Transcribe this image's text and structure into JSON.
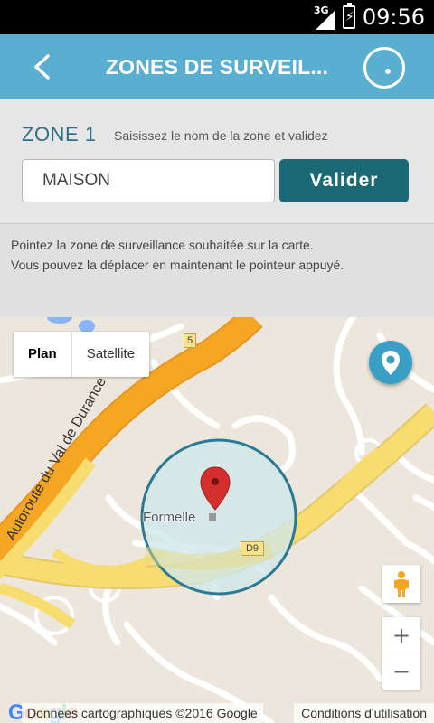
{
  "status_bar": {
    "network": "3G",
    "time": "09:56"
  },
  "app_bar": {
    "title": "ZONES DE SURVEIL...",
    "back_icon": "arrow-back-icon",
    "right_icon": "locate-target-icon"
  },
  "zone_form": {
    "zone_label": "ZONE 1",
    "hint": "Saisissez le nom de la zone et validez",
    "input_value": "MAISON",
    "submit_label": "Valider"
  },
  "instructions": {
    "line1": "Pointez la zone de surveillance souhaitée sur la carte.",
    "line2": "Vous pouvez la déplacer en maintenant le pointeur appuyé."
  },
  "map": {
    "map_type_options": [
      "Plan",
      "Satellite"
    ],
    "selected_map_type": "Plan",
    "place_name": "Formelle",
    "road_label_d9": "D9",
    "road_label_5": "5",
    "highway_name": "Autoroute du Val de Durance",
    "zoom_in": "+",
    "zoom_out": "−",
    "google_logo": "Google",
    "attribution": "Données cartographiques ©2016 Google",
    "terms": "Conditions d'utilisation",
    "colors": {
      "zone_circle_fill": "#cfe7ea",
      "zone_circle_stroke": "#2a7a93",
      "highway": "#f5a623",
      "road": "#f7dc6f",
      "marker": "#d32f2f",
      "fab": "#3a9fc4"
    }
  },
  "colors": {
    "app_bar": "#5aaed0",
    "button": "#1b6877",
    "zone_label": "#2d6f86"
  }
}
